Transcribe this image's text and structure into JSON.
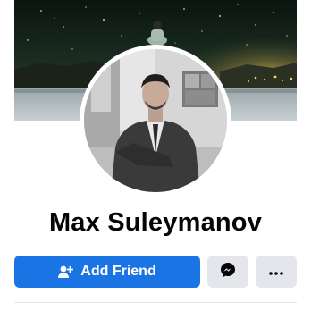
{
  "profile": {
    "name": "Max Suleymanov"
  },
  "actions": {
    "add_friend_label": "Add Friend",
    "add_friend_icon": "add-person-icon",
    "messenger_icon": "messenger-icon",
    "more_icon": "more-dots-icon"
  },
  "colors": {
    "primary": "#1b74e4",
    "secondary_bg": "#e4e6eb",
    "text": "#050505"
  }
}
